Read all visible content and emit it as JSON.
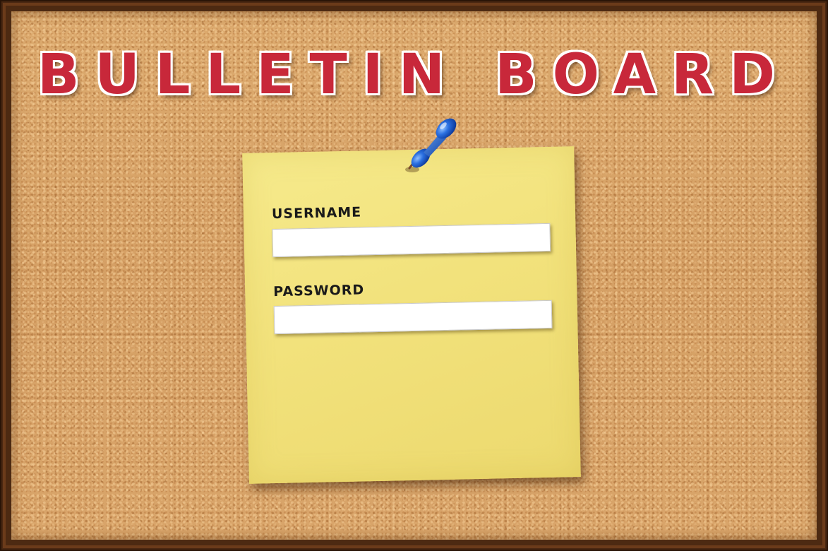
{
  "header": {
    "title": "BULLETIN BOARD"
  },
  "login_form": {
    "username_label": "USERNAME",
    "username_value": "",
    "password_label": "PASSWORD",
    "password_value": ""
  },
  "icons": {
    "pin": "pushpin-icon"
  },
  "colors": {
    "title_red": "#c8283a",
    "note_yellow": "#f2e27c",
    "cork": "#d9a66a",
    "frame": "#4a2812",
    "pin_blue": "#1f5fd6"
  }
}
